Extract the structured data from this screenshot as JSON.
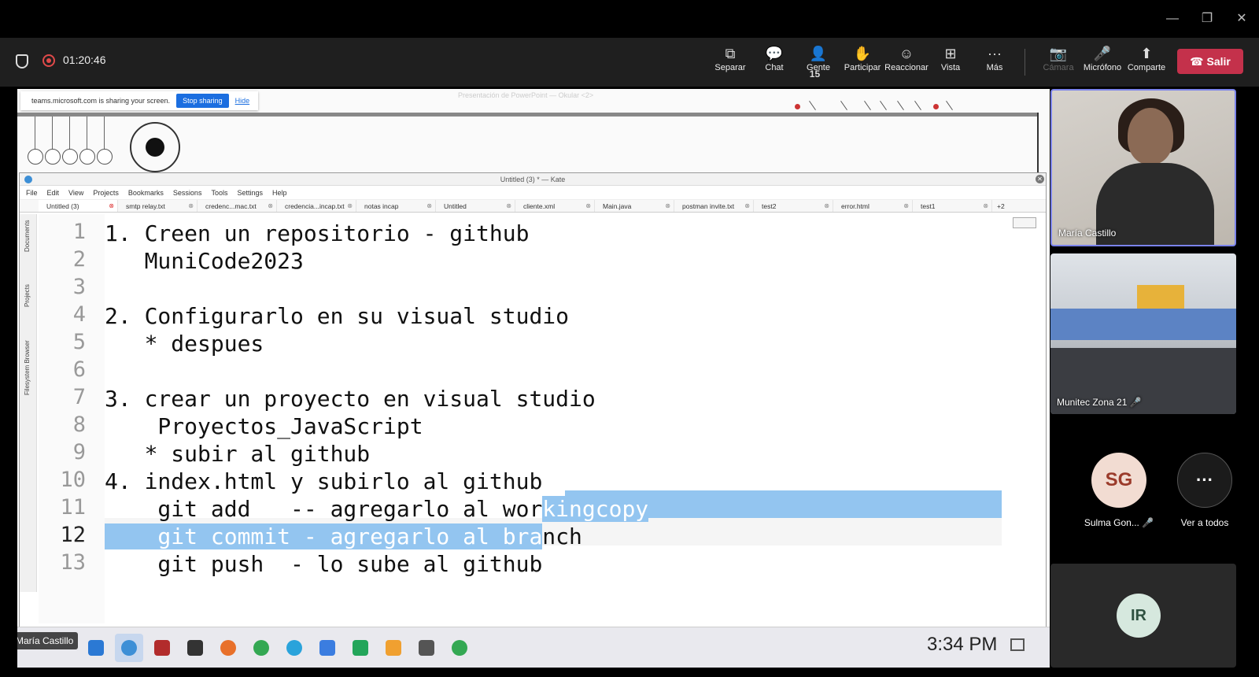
{
  "window": {
    "minimize": "—",
    "restore": "❐",
    "close": "✕"
  },
  "meeting": {
    "elapsed": "01:20:46",
    "toolbar": [
      {
        "name": "separar",
        "icon": "popout-icon",
        "glyph": "⧉",
        "label": "Separar"
      },
      {
        "name": "chat",
        "icon": "chat-icon",
        "glyph": "💬",
        "label": "Chat"
      },
      {
        "name": "gente",
        "icon": "people-icon",
        "glyph": "👤",
        "label": "Gente",
        "count": "15"
      },
      {
        "name": "participar",
        "icon": "raise-hand-icon",
        "glyph": "✋",
        "label": "Participar"
      },
      {
        "name": "reaccionar",
        "icon": "emoji-icon",
        "glyph": "☺",
        "label": "Reaccionar"
      },
      {
        "name": "vista",
        "icon": "grid-icon",
        "glyph": "⊞",
        "label": "Vista"
      },
      {
        "name": "mas",
        "icon": "more-icon",
        "glyph": "···",
        "label": "Más"
      }
    ],
    "media": [
      {
        "name": "camara",
        "icon": "camera-off-icon",
        "glyph": "📷",
        "label": "Cámara",
        "disabled": true
      },
      {
        "name": "microfono",
        "icon": "mic-off-icon",
        "glyph": "🎤",
        "label": "Micrófono",
        "disabled": false
      },
      {
        "name": "comparte",
        "icon": "share-icon",
        "glyph": "⬆",
        "label": "Comparte",
        "disabled": false
      }
    ],
    "leave_label": "Salir",
    "leave_color": "#c4314b"
  },
  "share_banner": {
    "text": "teams.microsoft.com is sharing your screen.",
    "stop": "Stop sharing",
    "hide": "Hide"
  },
  "okular": {
    "title": "Presentación de PowerPoint — Okular <2>"
  },
  "kate": {
    "title": "Untitled (3) * — Kate",
    "menu": [
      "File",
      "Edit",
      "View",
      "Projects",
      "Bookmarks",
      "Sessions",
      "Tools",
      "Settings",
      "Help"
    ],
    "tabs": [
      "Untitled (3)",
      "smtp relay.txt",
      "credenc...mac.txt",
      "credencia...incap.txt",
      "notas incap",
      "Untitled",
      "cliente.xml",
      "Main.java",
      "postman invite.txt",
      "test2",
      "error.html",
      "test1"
    ],
    "tabs_more": "+2",
    "side_panels": [
      "Documents",
      "Projects",
      "Filesystem Browser"
    ],
    "lines": [
      {
        "n": "1",
        "text": "1. Creen un repositorio - github"
      },
      {
        "n": "2",
        "text": "   MuniCode2023"
      },
      {
        "n": "3",
        "text": ""
      },
      {
        "n": "4",
        "text": "2. Configurarlo en su visual studio"
      },
      {
        "n": "5",
        "text": "   * despues"
      },
      {
        "n": "6",
        "text": ""
      },
      {
        "n": "7",
        "text": "3. crear un proyecto en visual studio"
      },
      {
        "n": "8",
        "text": "    Proyectos_JavaScript"
      },
      {
        "n": "9",
        "text": "   * subir al github"
      },
      {
        "n": "10",
        "text": "4. index.html y subirlo al github"
      },
      {
        "n": "11",
        "pre": "    git add   -- agregarlo al wor",
        "sel": "kingcopy",
        "post": ""
      },
      {
        "n": "12",
        "pre": "",
        "sel": "    git commit - agregarlo al bra",
        "post": "nch"
      },
      {
        "n": "13",
        "text": "    git push  - lo sube al github"
      }
    ],
    "current_line": "12"
  },
  "taskbar": {
    "presenter": "María Castillo",
    "clock": "3:34 PM",
    "apps": [
      "file-manager-icon",
      "kde-icon",
      "app-icon",
      "terminal-icon",
      "firefox-icon",
      "chrome-icon",
      "telegram-icon",
      "document-icon",
      "sheet-icon",
      "slides-icon",
      "screenshot-icon",
      "chrome-icon"
    ]
  },
  "participants": {
    "tile1_name": "María Castillo",
    "tile2_name": "Munitec Zona 21",
    "sg_initials": "SG",
    "sg_name": "Sulma Gon...",
    "more_label": "Ver a todos",
    "ir_initials": "IR"
  }
}
